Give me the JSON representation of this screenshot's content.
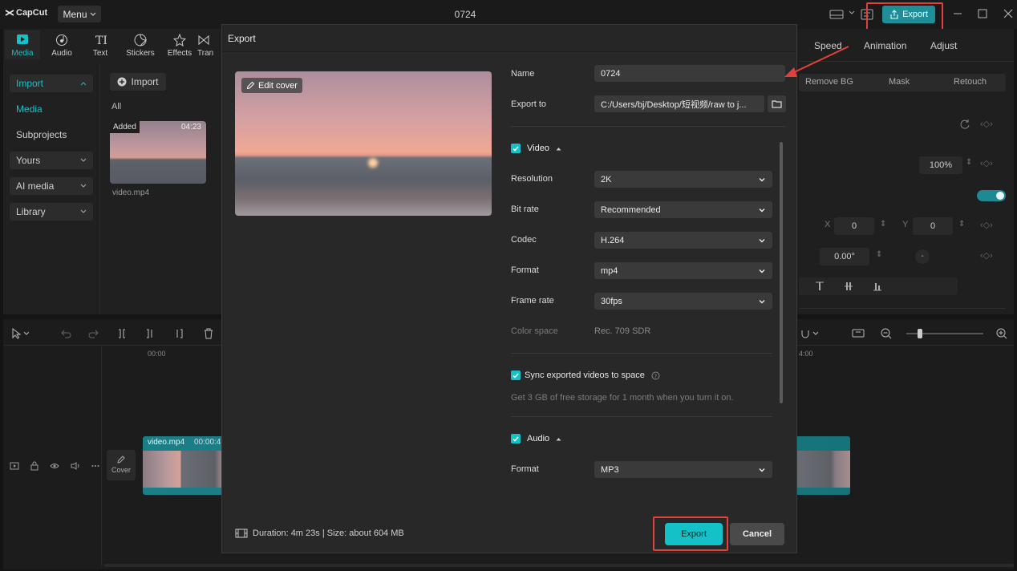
{
  "app": {
    "logo_text": "CapCut",
    "menu_label": "Menu",
    "project_title": "0724",
    "export_label": "Export"
  },
  "toolbar": {
    "tabs": [
      "Media",
      "Audio",
      "Text",
      "Stickers",
      "Effects",
      "Tran"
    ]
  },
  "left_nav": {
    "import_label": "Import",
    "items": [
      "Media",
      "Subprojects",
      "Yours",
      "AI media",
      "Library"
    ]
  },
  "media_panel": {
    "import_button": "Import",
    "filter": "All",
    "clip": {
      "badge": "Added",
      "duration": "04:23",
      "filename": "video.mp4"
    }
  },
  "right_panel": {
    "tabs": [
      "Speed",
      "Animation",
      "Adjust"
    ],
    "subtabs": [
      "Remove BG",
      "Mask",
      "Retouch"
    ],
    "scale_value": "100%",
    "x_label": "X",
    "x_value": "0",
    "y_label": "Y",
    "y_value": "0",
    "rotate_value": "0.00°"
  },
  "timeline": {
    "time_start": "00:00",
    "time_mark": "4:00",
    "clip_label": "video.mp4",
    "clip_time": "00:00:4",
    "cover_label": "Cover"
  },
  "modal": {
    "title": "Export",
    "edit_cover": "Edit cover",
    "name_label": "Name",
    "name_value": "0724",
    "export_to_label": "Export to",
    "export_to_value": "C:/Users/bj/Desktop/短视频/raw to j...",
    "video_label": "Video",
    "resolution_label": "Resolution",
    "resolution_value": "2K",
    "bitrate_label": "Bit rate",
    "bitrate_value": "Recommended",
    "codec_label": "Codec",
    "codec_value": "H.264",
    "format_label": "Format",
    "format_value": "mp4",
    "framerate_label": "Frame rate",
    "framerate_value": "30fps",
    "colorspace_label": "Color space",
    "colorspace_value": "Rec. 709 SDR",
    "sync_label": "Sync exported videos to space",
    "sync_desc": "Get 3 GB of free storage for 1 month when you turn it on.",
    "audio_label": "Audio",
    "audio_format_label": "Format",
    "audio_format_value": "MP3",
    "footer_info": "Duration: 4m 23s | Size: about 604 MB",
    "export_button": "Export",
    "cancel_button": "Cancel"
  },
  "colors": {
    "accent": "#14c1c7",
    "highlight": "#e0413a"
  }
}
